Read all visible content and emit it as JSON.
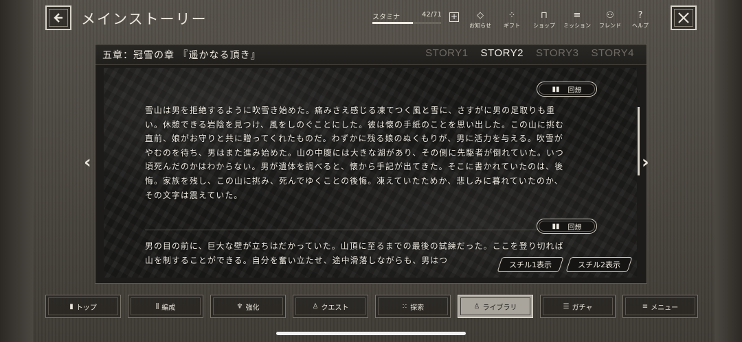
{
  "header": {
    "title": "メインストーリー",
    "stamina": {
      "label": "スタミナ",
      "value": "42/71",
      "current": 42,
      "max": 71
    },
    "nav": [
      {
        "icon": "notice-icon",
        "glyph": "◇",
        "label": "お知らせ"
      },
      {
        "icon": "gift-icon",
        "glyph": "⁘",
        "label": "ギフト"
      },
      {
        "icon": "shop-icon",
        "glyph": "⊓",
        "label": "ショップ"
      },
      {
        "icon": "mission-icon",
        "glyph": "≡",
        "label": "ミッション"
      },
      {
        "icon": "friend-icon",
        "glyph": "⚇",
        "label": "フレンド"
      },
      {
        "icon": "help-icon",
        "glyph": "?",
        "label": "ヘルプ"
      }
    ]
  },
  "panel": {
    "chapter_title": "五章：冠雪の章 『遥かなる頂き』",
    "tabs": [
      {
        "label": "STORY1",
        "active": false
      },
      {
        "label": "STORY2",
        "active": true
      },
      {
        "label": "STORY3",
        "active": false
      },
      {
        "label": "STORY4",
        "active": false
      }
    ],
    "recall_label": "回想",
    "paragraph1": "雪山は男を拒絶するように吹雪き始めた。痛みさえ感じる凍てつく風と雪に、さすがに男の足取りも重い。休憩できる岩陰を見つけ、風をしのぐことにした。彼は懐の手紙のことを思い出した。この山に挑む直前、娘がお守りと共に贈ってくれたものだ。わずかに残る娘のぬくもりが、男に活力を与える。吹雪がやむのを待ち、男はまた進み始めた。山の中腹には大きな湖があり、その側に先駆者が倒れていた。いつ頃死んだのかはわからない。男が遺体を調べると、懐から手記が出てきた。そこに書かれていたのは、後悔。家族を残し、この山に挑み、死んでゆくことの後悔。凍えていたためか、悲しみに暮れていたのか、その文字は震えていた。",
    "paragraph2": "男の目の前に、巨大な壁が立ちはだかっていた。山頂に至るまでの最後の試練だった。ここを登り切れば山を制することができる。自分を奮い立たせ、途中滑落しながらも、男はつ",
    "still1": "スチル1表示",
    "still2": "スチル2表示"
  },
  "bottom_nav": [
    {
      "icon": "top-icon",
      "glyph": "▮",
      "label": "トップ",
      "active": false
    },
    {
      "icon": "formation-icon",
      "glyph": "⫼",
      "label": "編成",
      "active": false
    },
    {
      "icon": "enhance-icon",
      "glyph": "♆",
      "label": "強化",
      "active": false
    },
    {
      "icon": "quest-icon",
      "glyph": "♙",
      "label": "クエスト",
      "active": false
    },
    {
      "icon": "explore-icon",
      "glyph": "⁙",
      "label": "探索",
      "active": false
    },
    {
      "icon": "library-icon",
      "glyph": "♙",
      "label": "ライブラリ",
      "active": true
    },
    {
      "icon": "gacha-icon",
      "glyph": "☰",
      "label": "ガチャ",
      "active": false
    },
    {
      "icon": "menu-icon",
      "glyph": "≡",
      "label": "メニュー",
      "active": false
    }
  ]
}
